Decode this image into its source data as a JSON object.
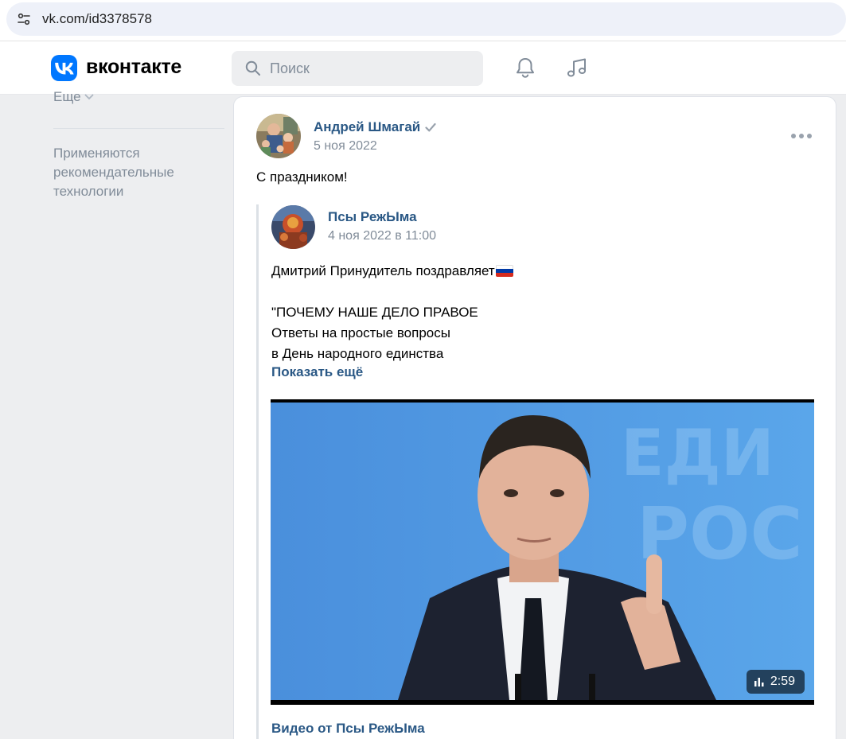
{
  "browser": {
    "url": "vk.com/id3378578"
  },
  "header": {
    "brand": "вконтакте",
    "search_placeholder": "Поиск"
  },
  "left_menu": {
    "more_label": "Еще",
    "note": "Применяются рекомендательные технологии"
  },
  "post": {
    "author": "Андрей Шмагай",
    "date": "5 ноя 2022",
    "text": "С праздником!",
    "repost": {
      "author": "Псы РежЫма",
      "date": "4 ноя 2022 в 11:00",
      "line1": "Дмитрий Принудитель поздравляет",
      "line2": "\"ПОЧЕМУ НАШЕ ДЕЛО ПРАВОЕ",
      "line3": "Ответы на простые вопросы",
      "line4": "в День народного единства",
      "show_more": "Показать ещё",
      "video": {
        "duration": "2:59",
        "title": "Видео от Псы РежЫма"
      }
    }
  },
  "colors": {
    "vk_blue": "#0077ff",
    "link": "#2a5885",
    "muted": "#818c99"
  }
}
